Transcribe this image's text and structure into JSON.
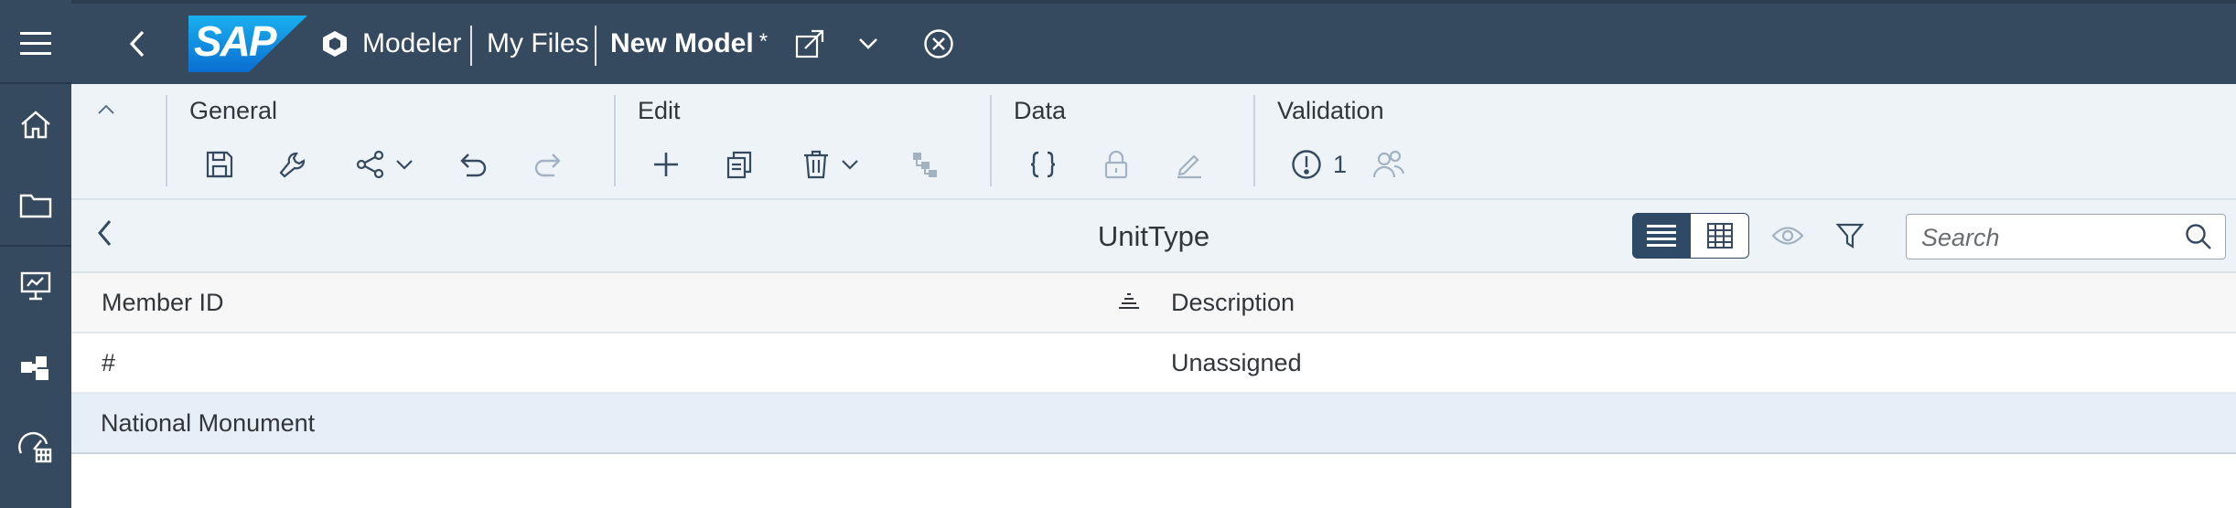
{
  "shell": {
    "logo_text": "SAP",
    "app_name": "Modeler",
    "breadcrumb": "My Files",
    "model_title": "New Model",
    "unsaved_marker": "*"
  },
  "toolbar": {
    "groups": {
      "general": "General",
      "edit": "Edit",
      "data": "Data",
      "validation": "Validation"
    },
    "validation_count": "1"
  },
  "panel": {
    "title": "UnitType",
    "search_placeholder": "Search"
  },
  "table": {
    "columns": [
      "Member ID",
      "Description"
    ],
    "rows": [
      {
        "member_id": "#",
        "description": "Unassigned"
      },
      {
        "member_id": "National Monument",
        "description": ""
      }
    ]
  },
  "colors": {
    "shell_bg": "#354a5f",
    "toolbar_bg": "#eef3f8",
    "accent": "#354a5f",
    "selected_row": "#e6eef7"
  },
  "icons": {
    "nav": [
      "menu-icon",
      "home-icon",
      "folder-icon",
      "presentation-icon",
      "puzzle-icon",
      "data-analyzer-icon"
    ],
    "general": [
      "save-icon",
      "wrench-icon",
      "share-icon",
      "undo-icon",
      "redo-icon"
    ],
    "edit": [
      "add-icon",
      "copy-icon",
      "delete-icon",
      "hierarchy-icon"
    ],
    "data": [
      "formula-braces-icon",
      "lock-icon",
      "edit-pencil-icon"
    ],
    "validation": [
      "alert-icon",
      "users-icon"
    ],
    "panel": [
      "list-view-icon",
      "grid-view-icon",
      "eye-icon",
      "filter-icon",
      "search-icon",
      "sort-icon"
    ]
  }
}
